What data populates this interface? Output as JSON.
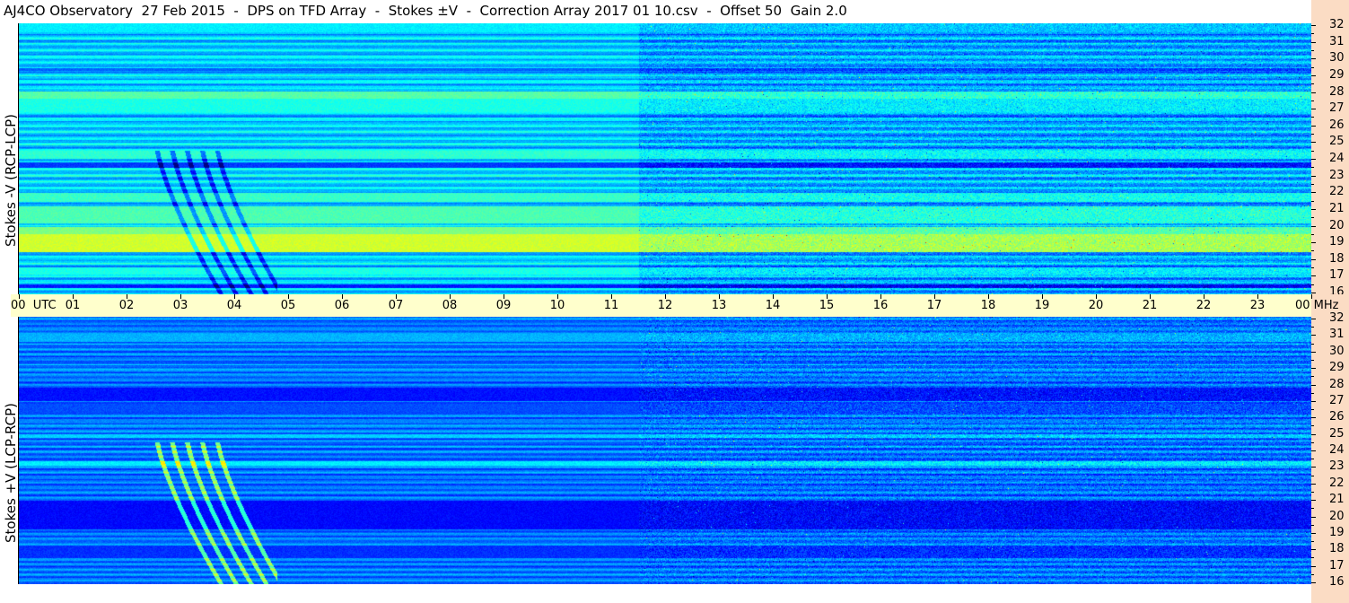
{
  "title": "AJ4CO Observatory  27 Feb 2015  -  DPS on TFD Array  -  Stokes ±V  -  Correction Array 2017 01 10.csv  -  Offset 50  Gain 2.0",
  "chart_data": [
    {
      "type": "heatmap",
      "panel": "top",
      "ylabel": "Stokes -V (RCP-LCP)",
      "x_range_utc_hours": [
        0,
        24
      ],
      "y_range_mhz": [
        16,
        32
      ],
      "colormap": "jet",
      "base_color": "#1a7ce6"
    },
    {
      "type": "heatmap",
      "panel": "bottom",
      "ylabel": "Stokes +V (LCP-RCP)",
      "x_range_utc_hours": [
        0,
        24
      ],
      "y_range_mhz": [
        16,
        32
      ],
      "colormap": "jet",
      "base_color": "#1e55d8"
    }
  ],
  "time_axis": {
    "labels": [
      "00  UTC",
      "01",
      "02",
      "03",
      "04",
      "05",
      "06",
      "07",
      "08",
      "09",
      "10",
      "11",
      "12",
      "13",
      "14",
      "15",
      "16",
      "17",
      "18",
      "19",
      "20",
      "21",
      "22",
      "23",
      "00 MHz"
    ]
  },
  "freq_axis": {
    "labels": [
      "32",
      "31",
      "30",
      "29",
      "28",
      "27",
      "26",
      "25",
      "24",
      "23",
      "22",
      "21",
      "20",
      "19",
      "18",
      "17",
      "16"
    ]
  },
  "colors": {
    "freq_axis_bg": "#fbdcc4",
    "time_axis_bg": "#ffffcc"
  }
}
